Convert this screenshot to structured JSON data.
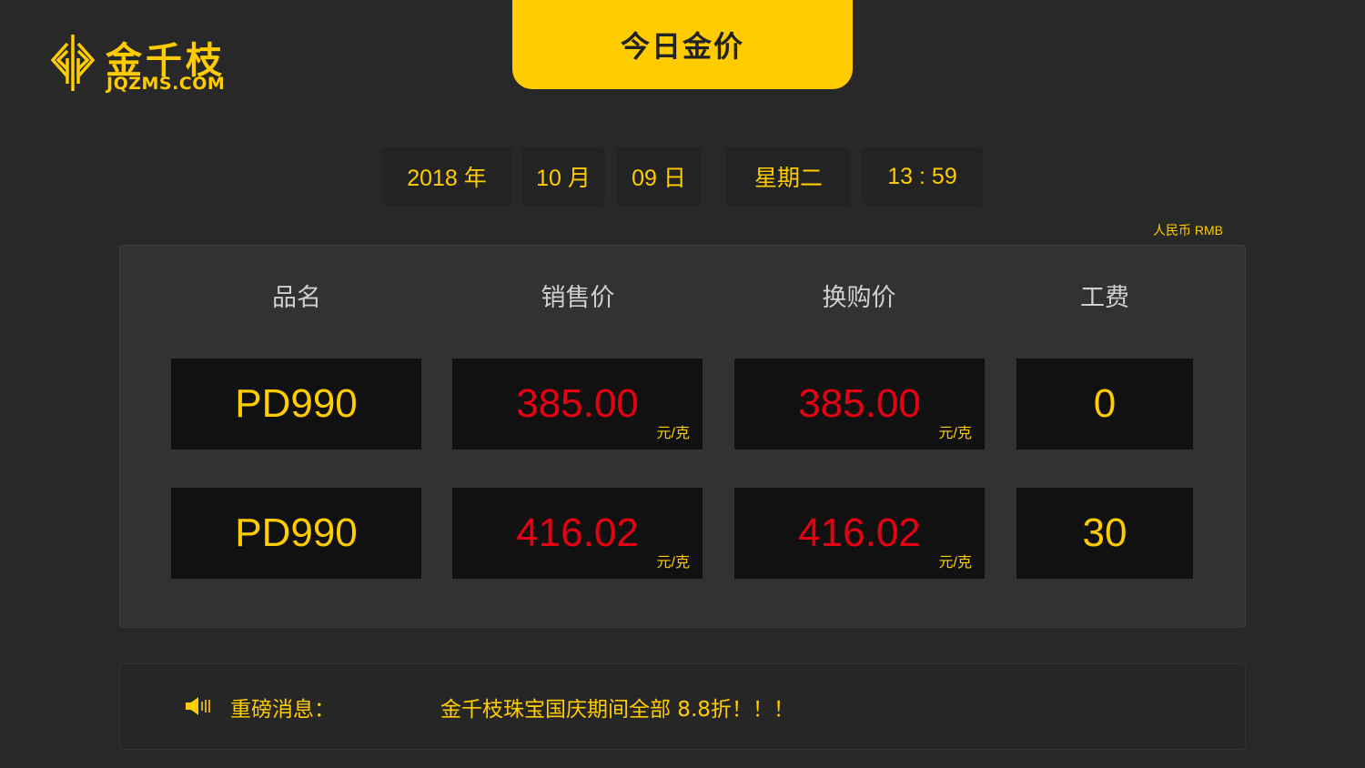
{
  "brand": {
    "name": "金千枝",
    "url": "JQZMS.COM"
  },
  "title": "今日金价",
  "date": {
    "year": "2018 年",
    "month": "10 月",
    "day": "09 日",
    "weekday": "星期二",
    "time": "13 : 59"
  },
  "currency": "人民币  RMB",
  "table": {
    "headers": [
      "品名",
      "销售价",
      "换购价",
      "工费"
    ],
    "unit": "元/克",
    "rows": [
      {
        "name": "PD990",
        "sale": "385.00",
        "exchange": "385.00",
        "fee": "0"
      },
      {
        "name": "PD990",
        "sale": "416.02",
        "exchange": "416.02",
        "fee": "30"
      }
    ]
  },
  "news": {
    "label": "重磅消息：",
    "text": "金千枝珠宝国庆期间全部 8.8折！！！"
  },
  "colors": {
    "accent": "#ffcc00",
    "price": "#e60012",
    "bg": "#282828"
  }
}
